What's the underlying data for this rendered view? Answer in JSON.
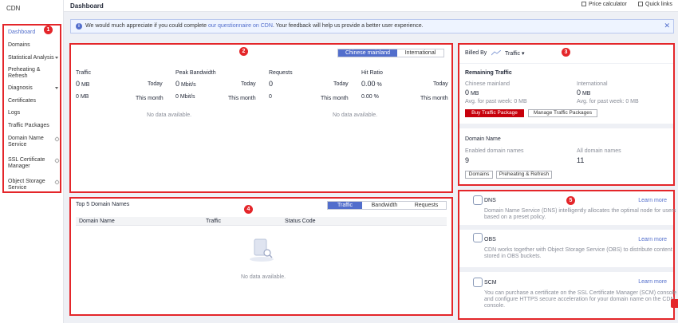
{
  "sidebar": {
    "title": "CDN",
    "items": [
      {
        "label": "Dashboard"
      },
      {
        "label": "Domains"
      },
      {
        "label": "Statistical Analysis"
      },
      {
        "label": "Preheating &"
      },
      {
        "label": "Refresh"
      },
      {
        "label": "Diagnosis"
      },
      {
        "label": "Certificates"
      },
      {
        "label": "Logs"
      },
      {
        "label": "Traffic Packages"
      },
      {
        "label": "Domain Name"
      },
      {
        "label": "Service"
      },
      {
        "label": "SSL Certificate"
      },
      {
        "label": "Manager"
      },
      {
        "label": "Object Storage"
      },
      {
        "label": "Service"
      }
    ]
  },
  "header": {
    "title": "Dashboard",
    "price_calculator": "Price calculator",
    "quick_links": "Quick links"
  },
  "notice": {
    "before": "We would much appreciate if you could complete ",
    "link": "our questionnaire on CDN",
    "after": ". Your feedback will help us provide a better user experience."
  },
  "badges": {
    "b1": "1",
    "b2": "2",
    "b3": "3",
    "b4": "4",
    "b5": "5"
  },
  "overview": {
    "tab_mainland": "Chinese mainland",
    "tab_international": "International",
    "today": "Today",
    "this_month": "This month",
    "no_data": "No data available.",
    "traffic": {
      "label": "Traffic",
      "today": "0",
      "today_unit": "MB",
      "month": "0 MB"
    },
    "peak": {
      "label": "Peak Bandwidth",
      "today": "0",
      "today_unit": "Mbit/s",
      "month": "0 Mbit/s"
    },
    "requests": {
      "label": "Requests",
      "today": "0",
      "month": "0"
    },
    "hit": {
      "label": "Hit Ratio",
      "today": "0.00",
      "today_unit": "%",
      "month": "0.00 %"
    }
  },
  "billing": {
    "billed_by": "Billed By",
    "mode": "Traffic",
    "remaining": "Remaining Traffic",
    "mainland": {
      "label": "Chinese mainland",
      "value": "0",
      "unit": "MB",
      "avg": "Avg. for past week: 0 MB"
    },
    "international": {
      "label": "International",
      "value": "0",
      "unit": "MB",
      "avg": "Avg. for past week: 0 MB"
    },
    "buy": "Buy Traffic Package",
    "manage": "Manage Traffic Packages",
    "domain_name": "Domain Name",
    "enabled_label": "Enabled domain names",
    "enabled_value": "9",
    "all_label": "All domain names",
    "all_value": "11",
    "btn_domains": "Domains",
    "btn_preheat": "Preheating & Refresh"
  },
  "top5": {
    "title": "Top 5 Domain Names",
    "tabs": [
      "Traffic",
      "Bandwidth",
      "Requests"
    ],
    "columns": [
      "Domain Name",
      "Traffic",
      "Status Code"
    ],
    "no_data": "No data available."
  },
  "services": [
    {
      "name": "DNS",
      "learn": "Learn more",
      "line1": "Domain Name Service (DNS) intelligently allocates the optimal node for users",
      "line2": "based on a preset policy."
    },
    {
      "name": "OBS",
      "learn": "Learn more",
      "line1": "CDN works together with Object Storage Service (OBS) to distribute content",
      "line2": "stored in OBS buckets."
    },
    {
      "name": "SCM",
      "learn": "Learn more",
      "line1": "You can purchase a certificate on the SSL Certificate Manager (SCM) console",
      "line2": "and configure HTTPS secure acceleration for your domain name on the CDN",
      "line3": "console."
    }
  ],
  "colors": {
    "accent": "#526ecc",
    "highlight": "#e4262a",
    "buy_button": "#c7000b"
  }
}
